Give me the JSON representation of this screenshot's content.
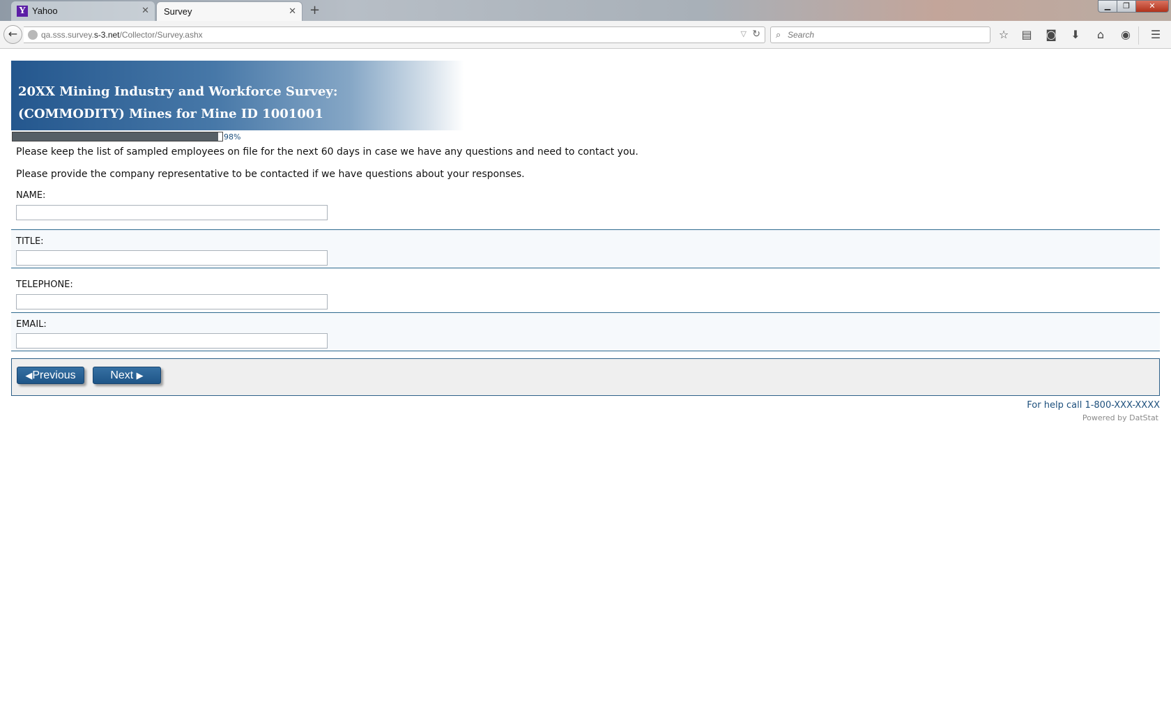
{
  "browser": {
    "tabs": [
      {
        "label": "Yahoo",
        "icon": "yahoo-favicon",
        "active": false
      },
      {
        "label": "Survey",
        "active": true
      }
    ],
    "url_host": "qa.sss.survey.",
    "url_domain": "s-3.net",
    "url_path": "/Collector/Survey.ashx",
    "search_placeholder": "Search"
  },
  "survey": {
    "title_line1": "20XX Mining Industry and Workforce Survey:",
    "title_line2": "(COMMODITY) Mines for Mine ID 1001001",
    "progress_percent": 98,
    "progress_label": "98%",
    "instruction1": "Please keep the list of sampled employees on file for the next 60 days in case we have any questions and need to contact you.",
    "instruction2": "Please provide the company representative to be contacted if we have questions about your responses.",
    "fields": [
      {
        "label": "NAME:",
        "value": ""
      },
      {
        "label": "TITLE:",
        "value": ""
      },
      {
        "label": "TELEPHONE:",
        "value": ""
      },
      {
        "label": "EMAIL:",
        "value": ""
      }
    ],
    "previous_label": "Previous",
    "next_label": "Next",
    "help_text": "For help call 1-800-XXX-XXXX",
    "powered_by": "Powered by DatStat"
  },
  "colors": {
    "banner_dark": "#24578e",
    "button": "#1f5587",
    "rule": "#2e6a8f",
    "progress_fill": "#565f66"
  }
}
